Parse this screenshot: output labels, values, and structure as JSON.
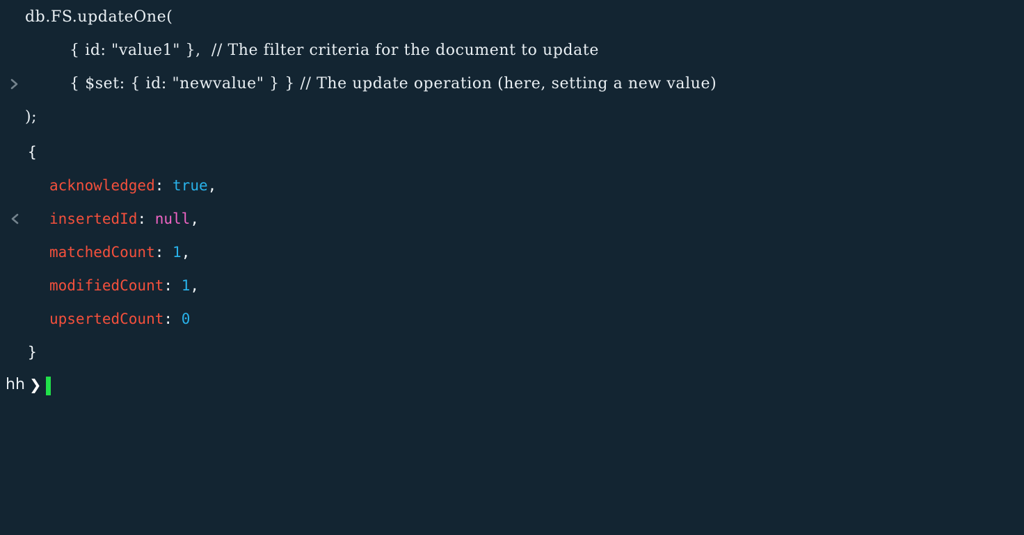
{
  "terminal": {
    "background_color": "#132532",
    "input_text_color": "#e9eff3",
    "gutter_color": "#74838d",
    "cursor_color": "#21e04a",
    "colors": {
      "key": "#f4503c",
      "boolean": "#29b2ea",
      "number": "#29b2ea",
      "null": "#ef64c4",
      "punctuation": "#f2f7fa"
    },
    "input_marker": "chevron-right-icon",
    "output_marker": "chevron-left-icon"
  },
  "command": {
    "marker": ">",
    "lines": [
      "db.FS.updateOne(",
      "{ id: \"value1\" },  // The filter criteria for the document to update",
      "{ $set: { id: \"newvalue\" } } // The update operation (here, setting a new value)",
      ");"
    ]
  },
  "result": {
    "marker": "<",
    "open_brace": "{",
    "close_brace": "}",
    "fields": [
      {
        "key": "acknowledged",
        "colon": ":",
        "value": "true",
        "value_type": "bool",
        "comma": ","
      },
      {
        "key": "insertedId",
        "colon": ":",
        "value": "null",
        "value_type": "null",
        "comma": ","
      },
      {
        "key": "matchedCount",
        "colon": ":",
        "value": "1",
        "value_type": "num",
        "comma": ","
      },
      {
        "key": "modifiedCount",
        "colon": ":",
        "value": "1",
        "value_type": "num",
        "comma": ","
      },
      {
        "key": "upsertedCount",
        "colon": ":",
        "value": "0",
        "value_type": "num",
        "comma": ""
      }
    ]
  },
  "prompt": {
    "host": "hh",
    "arrow": "❯",
    "input_value": ""
  }
}
